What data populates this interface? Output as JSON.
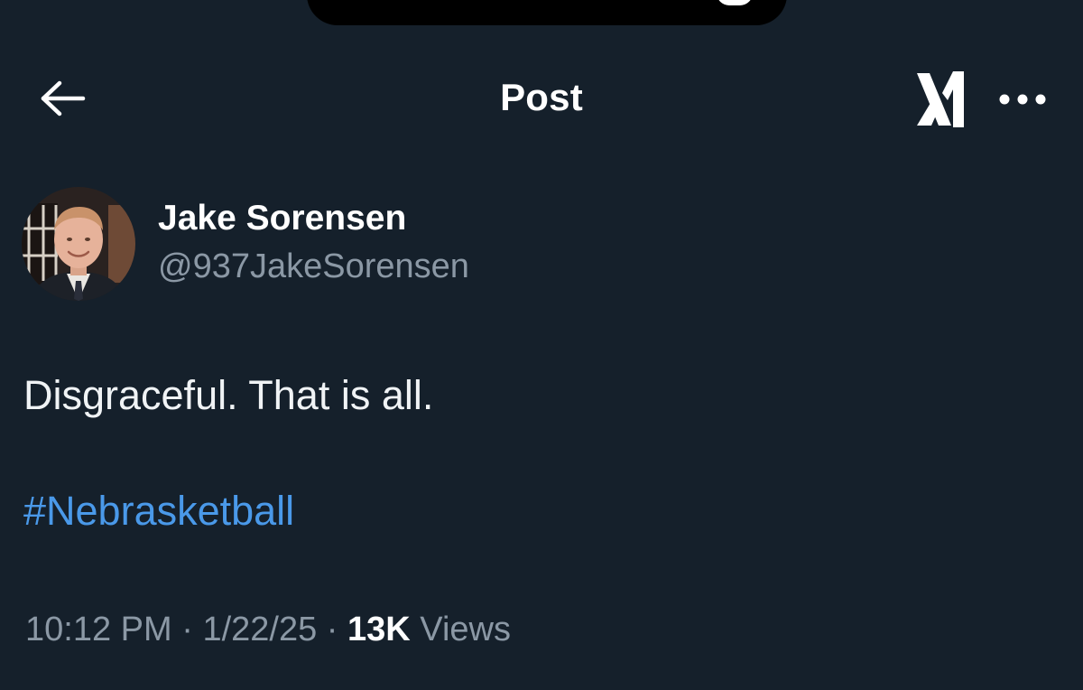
{
  "header": {
    "title": "Post",
    "back_icon": "arrow-left-icon",
    "grok_icon": "grok-logo-icon",
    "more_icon": "more-horizontal-icon"
  },
  "author": {
    "display_name": "Jake Sorensen",
    "handle": "@937JakeSorensen",
    "avatar_icon": "user-avatar-photo"
  },
  "post": {
    "text": "Disgraceful. That is all.",
    "hashtag": "#Nebrasketball"
  },
  "meta": {
    "time": "10:12 PM",
    "separator": "·",
    "date": "1/22/25",
    "views_count": "13K",
    "views_label": "Views"
  },
  "colors": {
    "background": "#15202b",
    "text_primary": "#ffffff",
    "text_secondary": "#8b98a5",
    "link": "#4a99e9"
  }
}
